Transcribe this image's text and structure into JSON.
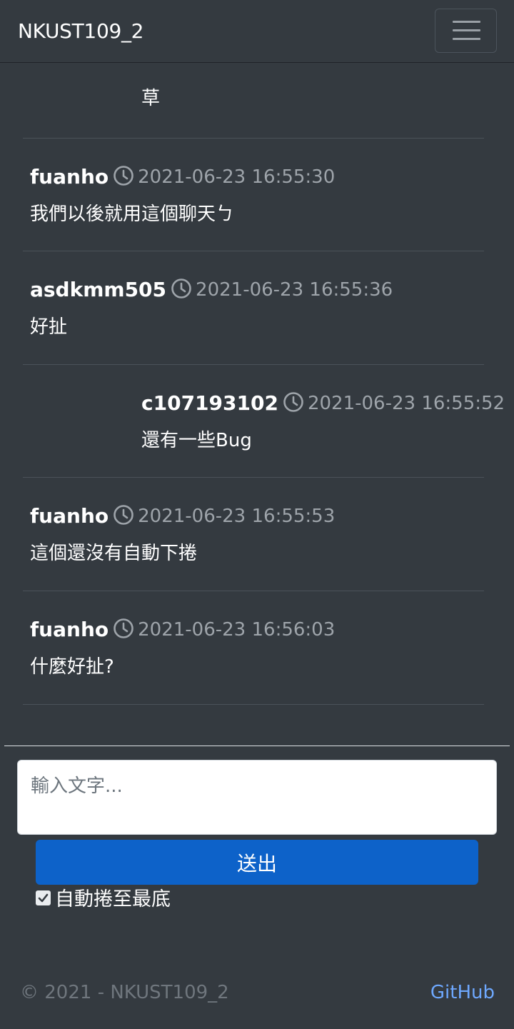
{
  "navbar": {
    "brand": "NKUST109_2",
    "toggler_icon": "hamburger-menu-icon"
  },
  "messages": [
    {
      "user": "",
      "time": "",
      "text": "草",
      "self": true
    },
    {
      "user": "fuanho",
      "time": "2021-06-23 16:55:30",
      "text": "我們以後就用這個聊天ㄅ",
      "self": false
    },
    {
      "user": "asdkmm505",
      "time": "2021-06-23 16:55:36",
      "text": "好扯",
      "self": false
    },
    {
      "user": "c107193102",
      "time": "2021-06-23 16:55:52",
      "text": "還有一些Bug",
      "self": true
    },
    {
      "user": "fuanho",
      "time": "2021-06-23 16:55:53",
      "text": "這個還沒有自動下捲",
      "self": false
    },
    {
      "user": "fuanho",
      "time": "2021-06-23 16:56:03",
      "text": "什麼好扯?",
      "self": false
    }
  ],
  "composer": {
    "placeholder": "輸入文字...",
    "value": "",
    "send_label": "送出",
    "autoscroll_label": "自動捲至最底",
    "autoscroll_checked": true
  },
  "footer": {
    "copyright": "© 2021 - NKUST109_2",
    "link_label": "GitHub"
  },
  "colors": {
    "background": "#343a40",
    "primary_button": "#0d62c9",
    "link": "#6ea8fe",
    "timestamp": "#9ea4aa"
  }
}
